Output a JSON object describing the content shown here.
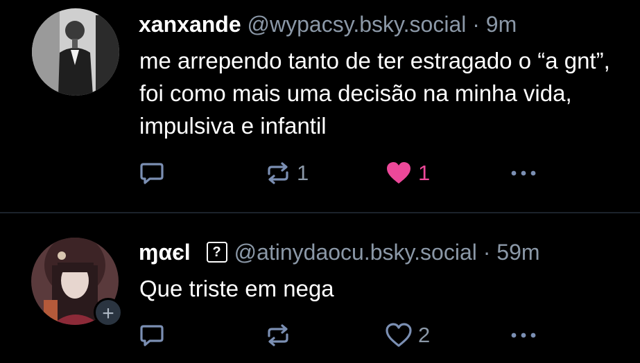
{
  "posts": [
    {
      "author_name": "xanxande",
      "handle": "@wypacsy.bsky.social",
      "separator": "·",
      "time": "9m",
      "text": "me arrependo tanto de ter estragado o “a gnt”, foi como mais uma decisão na minha vida, impulsiva e infantil",
      "reply_count": "",
      "repost_count": "1",
      "like_count": "1",
      "liked": true
    },
    {
      "author_name": "ɱαєl",
      "badge": "?",
      "handle": "@atinydaocu.bsky.social",
      "separator": "·",
      "time": "59m",
      "text": "Que triste em nega",
      "reply_count": "",
      "repost_count": "",
      "like_count": "2",
      "liked": false,
      "follow_badge": "+"
    }
  ],
  "icons": {
    "reply": "speech-bubble-icon",
    "repost": "repost-arrows-icon",
    "like": "heart-icon",
    "more": "ellipsis-icon"
  },
  "colors": {
    "background": "#000000",
    "muted": "#8b98a7",
    "like_active": "#ec4899",
    "icon_blue": "#7b8fb3"
  }
}
